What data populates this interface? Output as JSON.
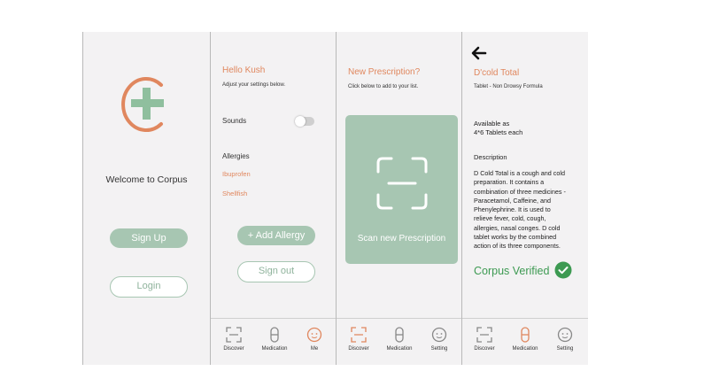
{
  "screen1": {
    "welcome": "Welcome to Corpus",
    "signup_label": "Sign Up",
    "login_label": "Login"
  },
  "screen2": {
    "greeting": "Hello Kush",
    "subtitle": "Adjust your settings below.",
    "sounds_label": "Sounds",
    "sounds_on": false,
    "allergies_heading": "Allergies",
    "allergies": [
      "Ibuprofen",
      "Shellfish"
    ],
    "add_allergy_label": "+ Add Allergy",
    "signout_label": "Sign out",
    "nav": [
      {
        "label": "Discover",
        "icon": "scan-icon"
      },
      {
        "label": "Medication",
        "icon": "pill-icon"
      },
      {
        "label": "Me",
        "icon": "face-icon"
      }
    ]
  },
  "screen3": {
    "title": "New Prescription?",
    "subtitle": "Click below to add to your list.",
    "scan_label": "Scan new Prescription",
    "nav": [
      {
        "label": "Discover",
        "icon": "scan-icon"
      },
      {
        "label": "Medication",
        "icon": "pill-icon"
      },
      {
        "label": "Setting",
        "icon": "face-icon"
      }
    ]
  },
  "screen4": {
    "title": "D'cold Total",
    "subtitle": "Tablet - Non Drowsy Formula",
    "available_line1": "Available as",
    "available_line2": "4*6 Tablets each",
    "description_heading": "Description",
    "description_lines": [
      "D Cold Total is a cough and cold",
      "preparation. It contains a",
      "combination of three medicines -",
      "Paracetamol, Caffeine, and",
      "Phenylephrine. It is used to",
      "relieve fever, cold, cough,",
      "allergies, nasal conges. D cold",
      "tablet works by the combined",
      "action of its three components."
    ],
    "verified_label": "Corpus Verified",
    "nav": [
      {
        "label": "Discover",
        "icon": "scan-icon"
      },
      {
        "label": "Medication",
        "icon": "pill-icon"
      },
      {
        "label": "Setting",
        "icon": "face-icon"
      }
    ]
  },
  "colors": {
    "accent_orange": "#e0875e",
    "accent_green": "#a7c6b2",
    "verified_green": "#3d9a52",
    "panel_bg": "#f3f2f3"
  }
}
